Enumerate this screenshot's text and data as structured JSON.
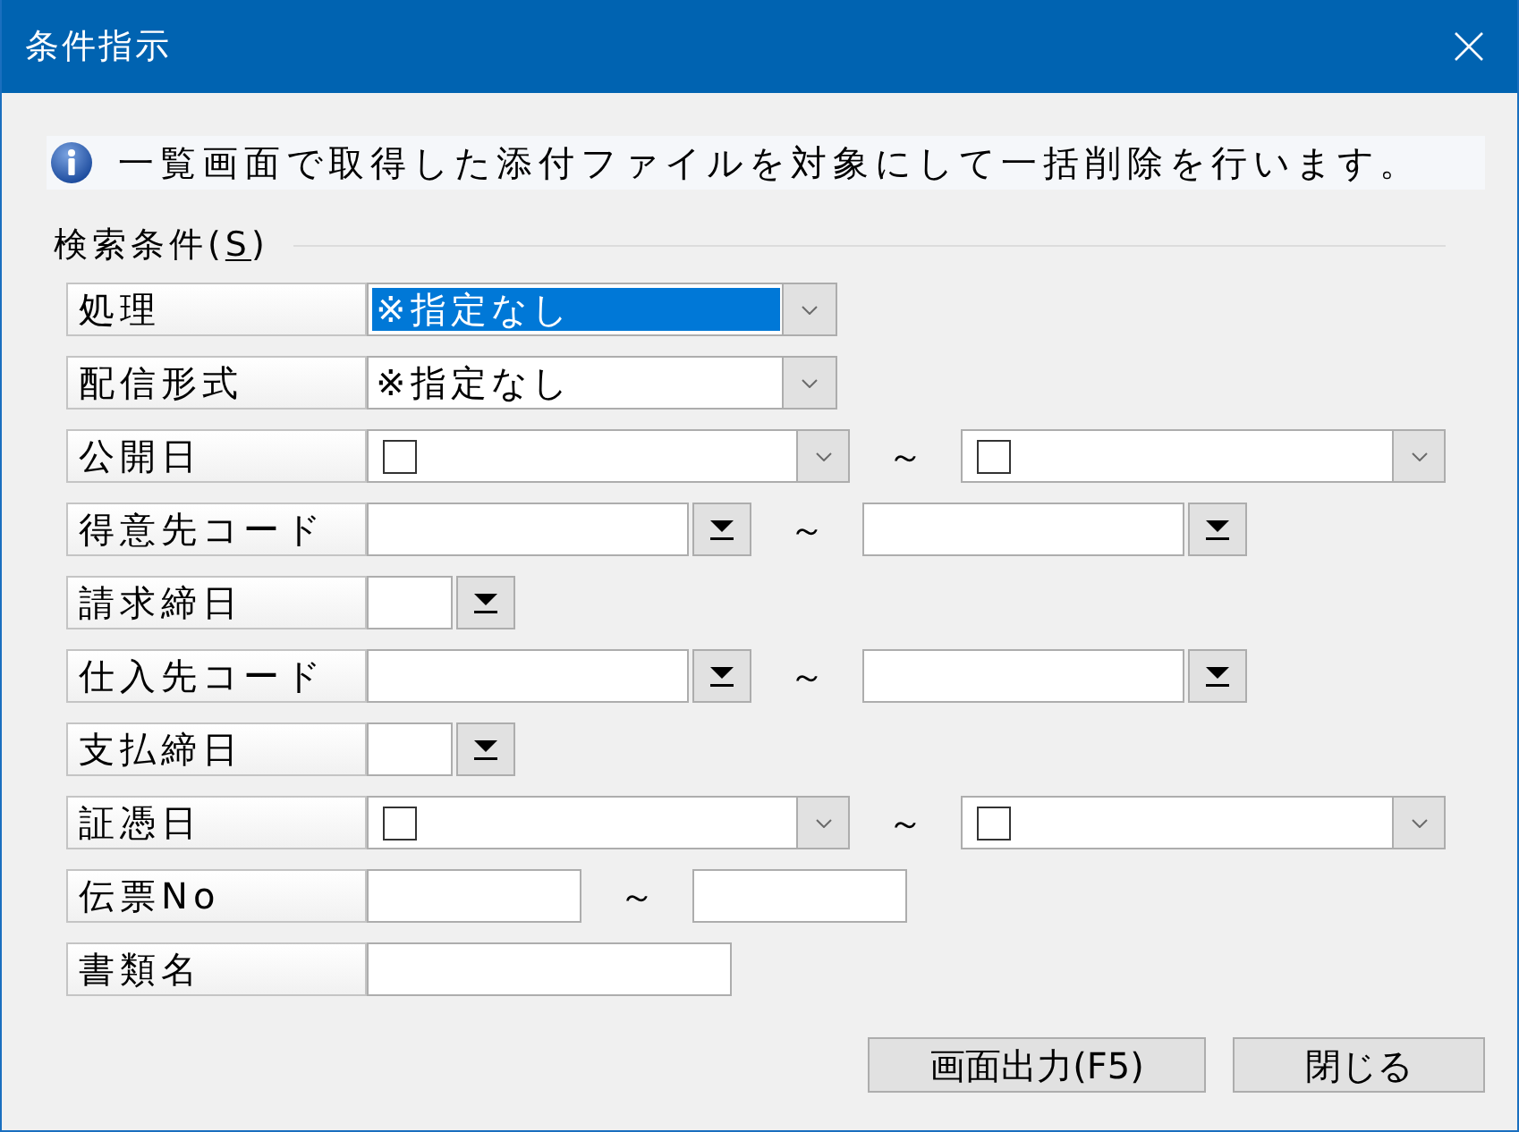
{
  "window": {
    "title": "条件指示"
  },
  "info": {
    "message": "一覧画面で取得した添付ファイルを対象にして一括削除を行います。"
  },
  "search_group": {
    "label": "検索条件(",
    "access_key": "S",
    "label_end": ")"
  },
  "fields": [
    {
      "kind": "combo",
      "label": "処理",
      "value": "※指定なし",
      "highlighted": true
    },
    {
      "kind": "combo",
      "label": "配信形式",
      "value": "※指定なし",
      "highlighted": false
    },
    {
      "kind": "date_range",
      "label": "公開日",
      "separator": "～",
      "from": {
        "checked": false
      },
      "to": {
        "checked": false
      }
    },
    {
      "kind": "code_range",
      "label": "得意先コード",
      "separator": "～"
    },
    {
      "kind": "day",
      "label": "請求締日"
    },
    {
      "kind": "code_range",
      "label": "仕入先コード",
      "separator": "～"
    },
    {
      "kind": "day",
      "label": "支払締日"
    },
    {
      "kind": "date_range",
      "label": "証憑日",
      "separator": "～",
      "from": {
        "checked": false
      },
      "to": {
        "checked": false
      }
    },
    {
      "kind": "text_range",
      "label": "伝票No",
      "separator": "～"
    },
    {
      "kind": "text",
      "label": "書類名"
    }
  ],
  "buttons": [
    {
      "label": "画面出力(F5)"
    },
    {
      "label": "閉じる"
    }
  ]
}
